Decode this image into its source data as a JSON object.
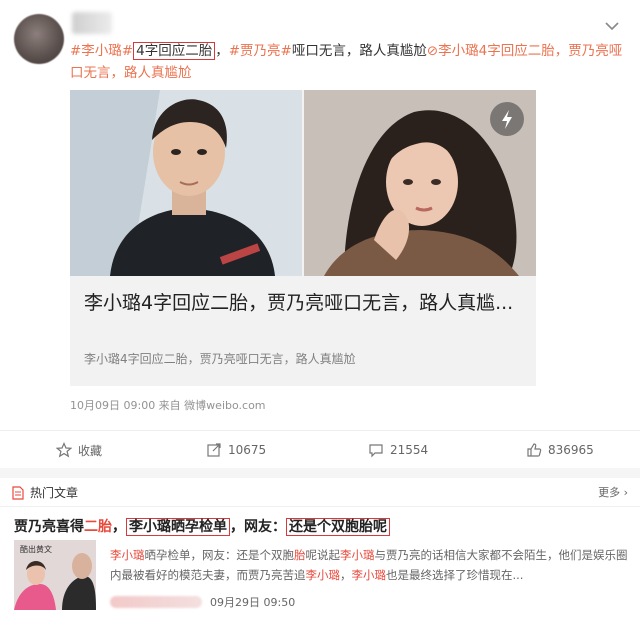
{
  "post": {
    "text_parts": [
      {
        "t": "#李小璐#",
        "style": "tag"
      },
      {
        "t": "4字回应二胎",
        "style": "box"
      },
      {
        "t": "，",
        "style": "plain"
      },
      {
        "t": "#贾乃亮#",
        "style": "tag"
      },
      {
        "t": "哑口无言，路人真尴尬",
        "style": "plain"
      },
      {
        "t": "⊘李小璐4字回应二胎，贾乃亮哑口无言，路人真尴尬",
        "style": "tag"
      }
    ],
    "link_card": {
      "title": "李小璐4字回应二胎，贾乃亮哑口无言，路人真尴...",
      "subtitle": "李小璐4字回应二胎，贾乃亮哑口无言，路人真尴尬"
    },
    "meta": "10月09日 09:00 来自 微博weibo.com"
  },
  "actions": {
    "favorite": "收藏",
    "repost": "10675",
    "comment": "21554",
    "like": "836965"
  },
  "hot": {
    "title": "热门文章",
    "more": "更多 ›",
    "article": {
      "title_parts": [
        {
          "t": "贾乃亮喜得",
          "style": "plain"
        },
        {
          "t": "二胎",
          "style": "red"
        },
        {
          "t": "，",
          "style": "plain"
        },
        {
          "t": "李小璐晒孕检单",
          "style": "boxmix"
        },
        {
          "t": "，网友：",
          "style": "plain"
        },
        {
          "t": "还是个双胞胎呢",
          "style": "boxmix2"
        }
      ],
      "summary_parts": [
        {
          "t": "李小璐",
          "style": "h"
        },
        {
          "t": "晒孕检单，网友：还是个双胞",
          "style": "plain"
        },
        {
          "t": "胎",
          "style": "h"
        },
        {
          "t": "呢说起",
          "style": "plain"
        },
        {
          "t": "李小璐",
          "style": "h"
        },
        {
          "t": "与贾乃亮的话相信大家都不会陌生，他们是娱乐圈内最被看好的模范夫妻，而贾乃亮苦追",
          "style": "plain"
        },
        {
          "t": "李小璐",
          "style": "h"
        },
        {
          "t": "，",
          "style": "plain"
        },
        {
          "t": "李小璐",
          "style": "h"
        },
        {
          "t": "也是最终选择了珍惜现在...",
          "style": "plain"
        }
      ],
      "date": "09月29日 09:50",
      "thumb_text": "酷出黄文"
    }
  },
  "colors": {
    "accent": "#eb7350",
    "highlight": "#e84a3c",
    "box": "#d63a3a"
  }
}
